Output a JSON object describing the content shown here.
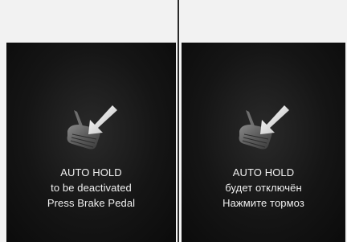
{
  "panels": [
    {
      "language": "en",
      "lines": [
        "AUTO HOLD",
        "to be deactivated",
        "Press Brake Pedal"
      ]
    },
    {
      "language": "ru",
      "lines": [
        "AUTO HOLD",
        "будет отключён",
        "Нажмите тормоз"
      ]
    }
  ],
  "icon": "brake-pedal-press-icon",
  "colors": {
    "background": "#f2f2f2",
    "panel": "#111111",
    "text": "#f0f0f0",
    "divider": "#2b2b2b"
  }
}
